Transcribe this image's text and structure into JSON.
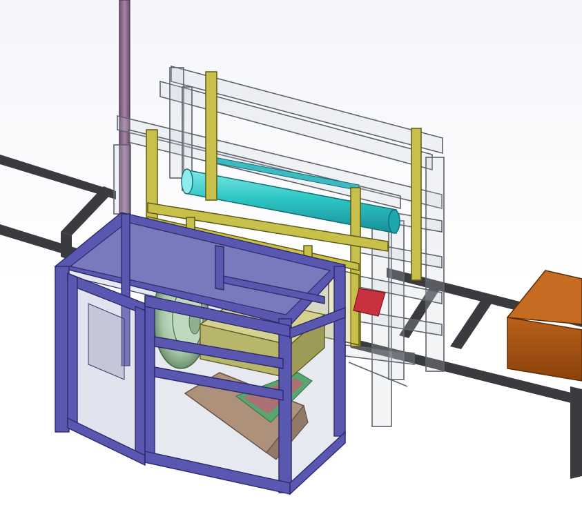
{
  "colors": {
    "rail": "#3a3b3f",
    "yellow_frame": "#c7c04a",
    "cyan_roller": "#2ec6c6",
    "enclosure_frame": "#5a57b0",
    "orange_box": "#9e4f0c",
    "pipe": "#8a6a8c",
    "olive_box": "#b8b66a",
    "fan_disc": "#a4c6a4",
    "red_tray": "#c8323e"
  },
  "parts": [
    "conveyor-rails",
    "vertical-pipe",
    "transparent-outer-frame",
    "yellow-lift-frame",
    "cyan-roller",
    "blue-enclosure",
    "enclosure-door",
    "fan-disc",
    "olive-box",
    "brown-chute",
    "red-tray",
    "orange-box"
  ]
}
